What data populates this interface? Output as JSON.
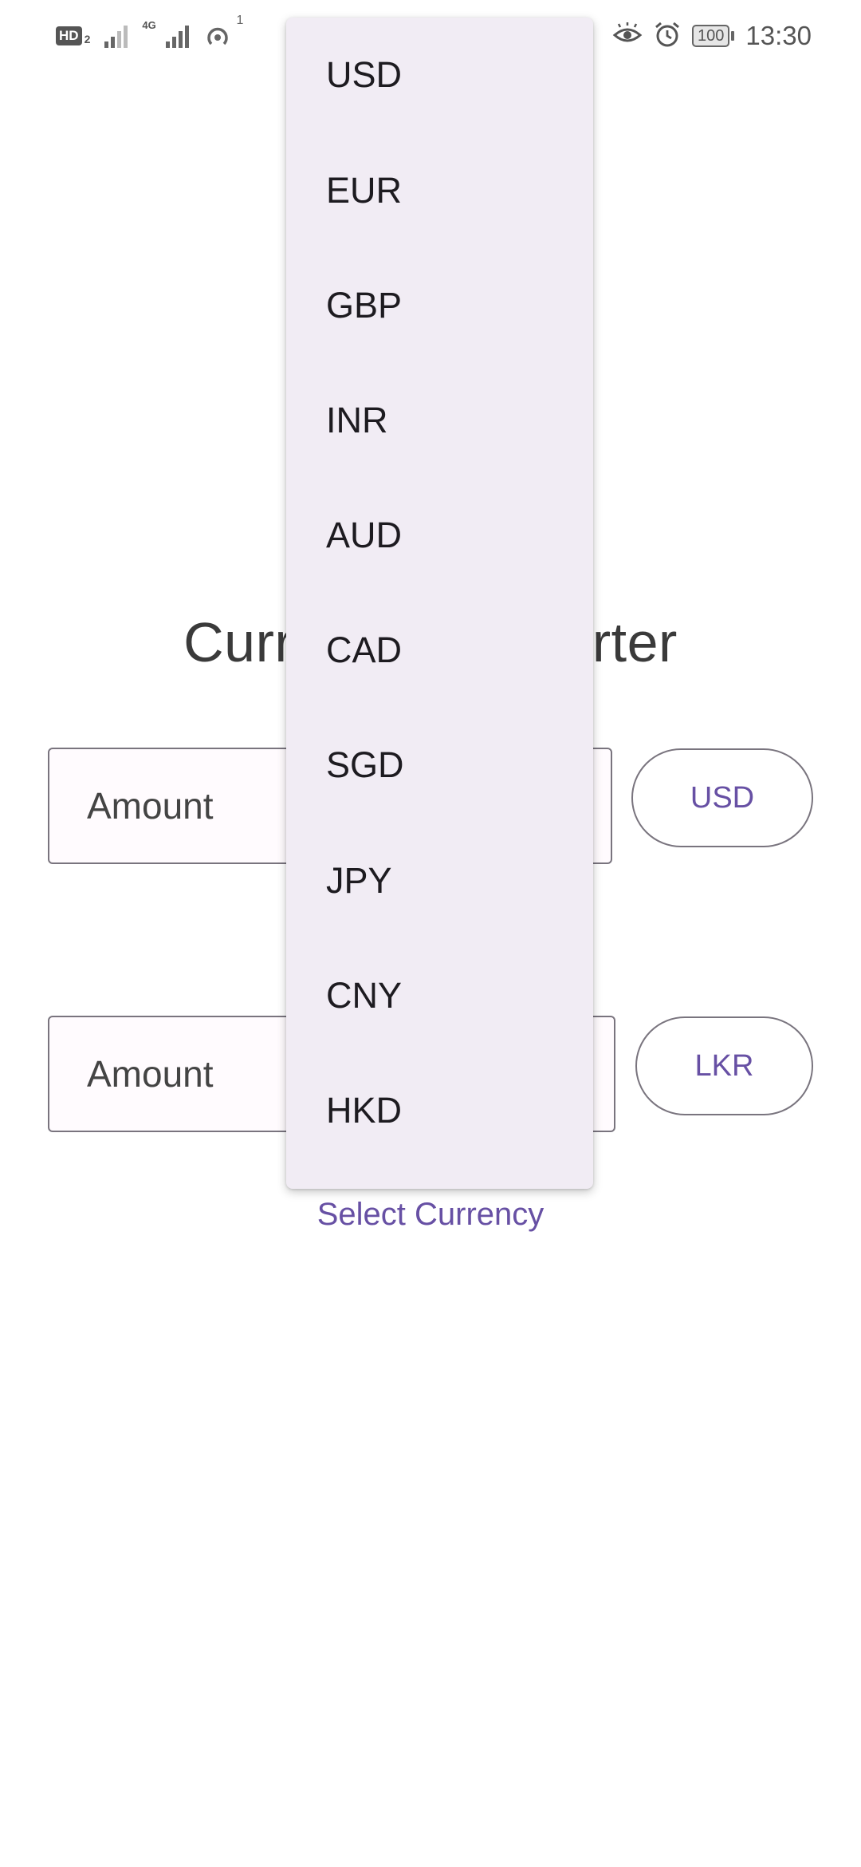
{
  "status_bar": {
    "hd_label": "HD",
    "hd_sim": "2",
    "network_label": "4G",
    "hotspot_count": "1",
    "battery_level": "100",
    "time": "13:30"
  },
  "app": {
    "title": "Currency Converter",
    "from_amount_label": "Amount",
    "to_amount_label": "Amount",
    "from_currency": "USD",
    "to_currency": "LKR",
    "select_currency_label": "Select Currency"
  },
  "dropdown": {
    "items": [
      "USD",
      "EUR",
      "GBP",
      "INR",
      "AUD",
      "CAD",
      "SGD",
      "JPY",
      "CNY",
      "HKD"
    ]
  },
  "colors": {
    "accent": "#6750a4",
    "menu_background": "#f1ecf4",
    "field_border": "#79747e"
  }
}
